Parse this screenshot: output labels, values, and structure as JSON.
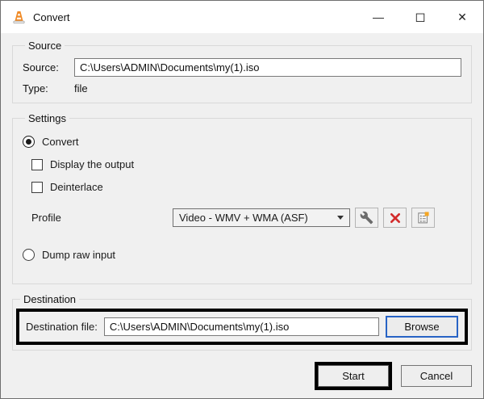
{
  "window": {
    "title": "Convert",
    "controls": {
      "minimize": "—",
      "maximize": "◻",
      "close": "✕"
    }
  },
  "source_group": {
    "title": "Source",
    "source_label": "Source:",
    "source_value": "C:\\Users\\ADMIN\\Documents\\my(1).iso",
    "type_label": "Type:",
    "type_value": "file"
  },
  "settings_group": {
    "title": "Settings",
    "convert_radio": {
      "label": "Convert",
      "selected": true
    },
    "display_output_checkbox": {
      "label": "Display the output",
      "checked": false
    },
    "deinterlace_checkbox": {
      "label": "Deinterlace",
      "checked": false
    },
    "profile_label": "Profile",
    "profile_value": "Video - WMV + WMA (ASF)",
    "profile_buttons": [
      "edit-profile",
      "delete-profile",
      "new-profile"
    ],
    "dump_raw_radio": {
      "label": "Dump raw input",
      "selected": false
    }
  },
  "destination_group": {
    "title": "Destination",
    "file_label": "Destination file:",
    "file_value": "C:\\Users\\ADMIN\\Documents\\my(1).iso",
    "browse_button": "Browse"
  },
  "actions": {
    "start": "Start",
    "cancel": "Cancel"
  },
  "colors": {
    "dialog_bg": "#f0f0f0",
    "titlebar_bg": "#ffffff",
    "highlight_border": "#000000",
    "browse_accent_blue": "#2763c5",
    "delete_icon_red": "#d22b2b",
    "vlc_cone_orange": "#f08924",
    "new_profile_badge_orange": "#f5a623"
  }
}
